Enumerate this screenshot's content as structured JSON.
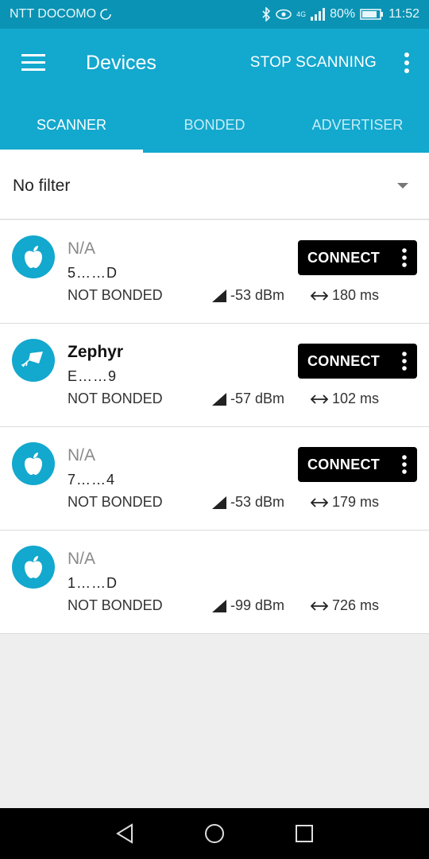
{
  "status_bar": {
    "carrier": "NTT DOCOMO",
    "network": "4G",
    "battery": "80%",
    "time": "11:52"
  },
  "app_bar": {
    "title": "Devices",
    "stop_label": "STOP SCANNING"
  },
  "tabs": [
    {
      "label": "SCANNER",
      "active": true
    },
    {
      "label": "BONDED",
      "active": false
    },
    {
      "label": "ADVERTISER",
      "active": false
    }
  ],
  "filter": {
    "label": "No filter"
  },
  "devices": [
    {
      "name": "N/A",
      "address": "5……D",
      "bond": "NOT BONDED",
      "rssi": "-53 dBm",
      "interval": "180 ms",
      "connect_label": "CONNECT",
      "icon": "apple-icon"
    },
    {
      "name": "Zephyr",
      "address": "E……9",
      "bond": "NOT BONDED",
      "rssi": "-57 dBm",
      "interval": "102 ms",
      "connect_label": "CONNECT",
      "icon": "zephyr-kite-icon"
    },
    {
      "name": "N/A",
      "address": "7……4",
      "bond": "NOT BONDED",
      "rssi": "-53 dBm",
      "interval": "179 ms",
      "connect_label": "CONNECT",
      "icon": "apple-icon"
    },
    {
      "name": "N/A",
      "address": "1……D",
      "bond": "NOT BONDED",
      "rssi": "-99 dBm",
      "interval": "726 ms",
      "icon": "apple-icon"
    }
  ],
  "colors": {
    "primary": "#13a8ce",
    "status_bar": "#0a93b4",
    "connect_button": "#000000"
  }
}
